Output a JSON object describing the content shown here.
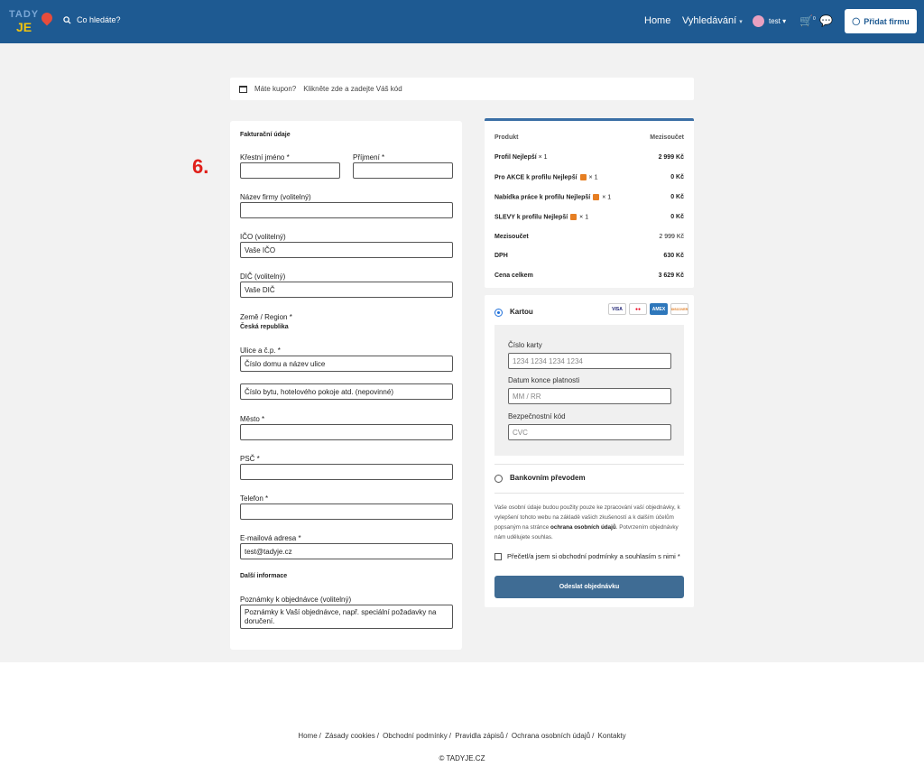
{
  "header": {
    "logo_top": "TADY",
    "logo_bottom": "JE",
    "search_placeholder": "Co hledáte?",
    "nav_home": "Home",
    "nav_search": "Vyhledávání",
    "user_name": "test",
    "cart_count": "0",
    "add_company_label": "Přidat firmu"
  },
  "coupon": {
    "question": "Máte kupon?",
    "link": "Klikněte zde a zadejte Váš kód"
  },
  "step_number": "6.",
  "billing": {
    "section_title": "Fakturační údaje",
    "first_name_label": "Křestní jméno *",
    "last_name_label": "Příjmení *",
    "company_label": "Název firmy (volitelný)",
    "ico_label": "IČO (volitelný)",
    "ico_value": "Vaše IČO",
    "dic_label": "DIČ (volitelný)",
    "dic_value": "Vaše DIČ",
    "country_label": "Země / Region *",
    "country_value": "Česká republika",
    "street_label": "Ulice a č.p. *",
    "street_value": "Číslo domu a název ulice",
    "street2_value": "Číslo bytu, hotelového pokoje atd. (nepovinné)",
    "city_label": "Město *",
    "zip_label": "PSČ *",
    "phone_label": "Telefon *",
    "email_label": "E-mailová adresa *",
    "email_value": "test@tadyje.cz",
    "extra_title": "Další informace",
    "notes_label": "Poznámky k objednávce (volitelný)",
    "notes_value": "Poznámky k Vaší objednávce, např. speciální požadavky na doručení."
  },
  "order": {
    "col_product": "Produkt",
    "col_subtotal": "Mezisoučet",
    "items": [
      {
        "name": "Profil Nejlepší",
        "qty": "× 1",
        "price": "2 999 Kč",
        "chip": false
      },
      {
        "name": "Pro AKCE k profilu Nejlepší",
        "qty": "× 1",
        "price": "0 Kč",
        "chip": true
      },
      {
        "name": "Nabídka práce k profilu Nejlepší",
        "qty": "× 1",
        "price": "0 Kč",
        "chip": true
      },
      {
        "name": "SLEVY k profilu Nejlepší",
        "qty": "× 1",
        "price": "0 Kč",
        "chip": true
      }
    ],
    "subtotal_label": "Mezisoučet",
    "subtotal_value": "2 999 Kč",
    "vat_label": "DPH",
    "vat_value": "630 Kč",
    "total_label": "Cena celkem",
    "total_value": "3 629 Kč"
  },
  "payment": {
    "card_label": "Kartou",
    "cards": [
      "VISA",
      "MC",
      "AMEX",
      "DISCOVER"
    ],
    "card_number_label": "Číslo karty",
    "card_number_placeholder": "1234 1234 1234 1234",
    "expiry_label": "Datum konce platnosti",
    "expiry_placeholder": "MM / RR",
    "cvc_label": "Bezpečnostní kód",
    "cvc_placeholder": "CVC",
    "bank_label": "Bankovním převodem",
    "privacy_text": "Vaše osobní údaje budou použity pouze ke zpracování vaší objednávky, k vylepšení tohoto webu na základě vašich zkušeností a k dalším účelům popsaným na stránce",
    "privacy_link": "ochrana osobních údajů",
    "privacy_tail": ". Potvrzením objednávky nám udělujete souhlas.",
    "terms_label": "Přečetl/a jsem si obchodní podmínky a souhlasím s nimi *",
    "submit_label": "Odeslat objednávku"
  },
  "footer": {
    "links": [
      "Home",
      "Zásady cookies",
      "Obchodní podmínky",
      "Pravidla zápisů",
      "Ochrana osobních údajů",
      "Kontakty"
    ],
    "copyright": "© TADYJE.CZ"
  }
}
